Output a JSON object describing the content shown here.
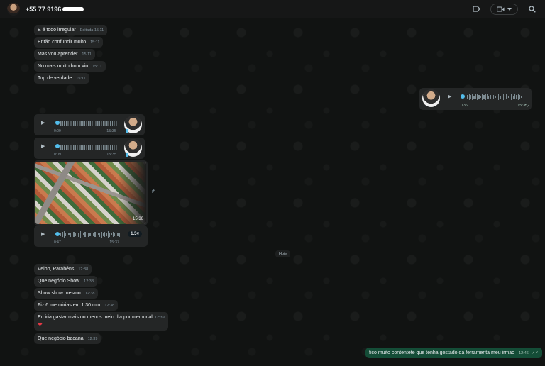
{
  "header": {
    "contact_name": "+55 77 9196"
  },
  "messages_in_top": [
    {
      "text": "E é todo irregular",
      "edited": "Editada",
      "time": "15:11"
    },
    {
      "text": "Então confundir muito",
      "time": "15:11"
    },
    {
      "text": "Mas vou aprender",
      "time": "15:11"
    },
    {
      "text": "No mais muito bom viu",
      "time": "15:11"
    },
    {
      "text": "Top de verdade",
      "time": "15:11"
    }
  ],
  "audio_out": {
    "duration": "0:36",
    "time": "15:25"
  },
  "audios_in": [
    {
      "duration": "0:09",
      "time": "15:35"
    },
    {
      "duration": "0:09",
      "time": "15:35"
    }
  ],
  "photo": {
    "time": "15:36"
  },
  "audio_in_3": {
    "duration": "0:47",
    "time": "15:37",
    "speed": "1,5×"
  },
  "date_chip": "Hoje",
  "messages_in_today": [
    {
      "text": "Velho, Parabéns",
      "time": "12:38"
    },
    {
      "text": "Que negócio Show",
      "time": "12:38"
    },
    {
      "text": "Show show mesmo",
      "time": "12:38"
    },
    {
      "text": "Fiz 6 memórias em 1:30 min",
      "time": "12:38"
    },
    {
      "text": "Eu iria gastar mais ou menos meio dia por memorial",
      "time": "12:39"
    },
    {
      "text": "Que negócio bacana",
      "time": "12:39"
    }
  ],
  "message_out_last": {
    "text": "fico muito contentete que tenha gostado da ferramenta meu irmao",
    "time": "12:46"
  }
}
